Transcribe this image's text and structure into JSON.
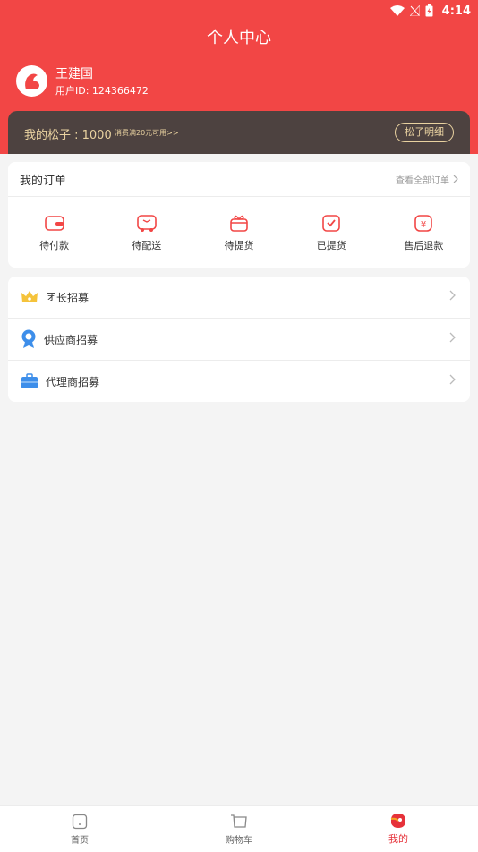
{
  "status_bar": {
    "time": "4:14"
  },
  "header": {
    "title": "个人中心"
  },
  "user": {
    "name": "王建国",
    "id_label": "用户ID: 124366472"
  },
  "points": {
    "label": "我的松子 : 1000",
    "tip": "消费满20元可用>>",
    "detail_button": "松子明细"
  },
  "orders": {
    "title": "我的订单",
    "view_all": "查看全部订单",
    "items": [
      {
        "label": "待付款",
        "icon": "wallet-icon"
      },
      {
        "label": "待配送",
        "icon": "delivery-icon"
      },
      {
        "label": "待提货",
        "icon": "gift-box-icon"
      },
      {
        "label": "已提货",
        "icon": "check-box-icon"
      },
      {
        "label": "售后退款",
        "icon": "refund-icon"
      }
    ]
  },
  "menu": [
    {
      "label": "团长招募",
      "icon": "crown-icon"
    },
    {
      "label": "供应商招募",
      "icon": "medal-icon"
    },
    {
      "label": "代理商招募",
      "icon": "briefcase-icon"
    }
  ],
  "tabbar": [
    {
      "label": "首页",
      "icon": "home-icon"
    },
    {
      "label": "购物车",
      "icon": "cart-icon"
    },
    {
      "label": "我的",
      "icon": "profile-icon",
      "active": true
    }
  ],
  "colors": {
    "accent": "#f24645",
    "points_bg": "#4d4240",
    "points_text": "#e9d2a0",
    "active_tab": "#e6323a"
  }
}
